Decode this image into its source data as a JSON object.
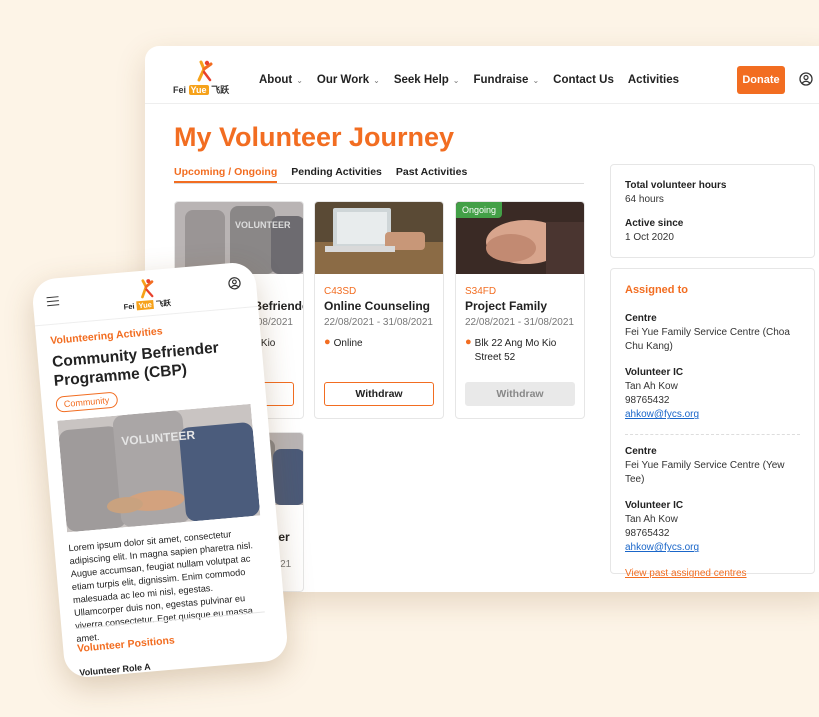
{
  "nav": {
    "logo_text_a": "Fei",
    "logo_text_b": "Yue",
    "logo_text_c": "飞跃",
    "links": [
      {
        "label": "About",
        "has_menu": true
      },
      {
        "label": "Our Work",
        "has_menu": true
      },
      {
        "label": "Seek Help",
        "has_menu": true
      },
      {
        "label": "Fundraise",
        "has_menu": true
      },
      {
        "label": "Contact Us",
        "has_menu": false
      },
      {
        "label": "Activities",
        "has_menu": false
      }
    ],
    "chevron": "⌄",
    "donate_label": "Donate"
  },
  "page": {
    "title": "My Volunteer Journey",
    "tabs": [
      "Upcoming / Ongoing",
      "Pending Activities",
      "Past Activities"
    ]
  },
  "cards": [
    {
      "code": "",
      "name": "Community Befriender",
      "date": "22/08/2021 - 31/08/2021",
      "location": "Blk 22 Ang Mo Kio",
      "button": "Withdraw"
    },
    {
      "code": "C43SD",
      "name": "Online Counseling",
      "date": "22/08/2021 - 31/08/2021",
      "location": "Online",
      "button": "Withdraw"
    },
    {
      "code": "S34FD",
      "name": "Project Family",
      "date": "22/08/2021 - 31/08/2021",
      "location": "Blk 22 Ang Mo Kio Street 52",
      "button": "Withdraw",
      "badge": "Ongoing"
    },
    {
      "name_tail": "ender",
      "date_tail": "2021"
    }
  ],
  "stats": {
    "hours_label": "Total volunteer hours",
    "hours_value": "64 hours",
    "since_label": "Active since",
    "since_value": "1 Oct 2020"
  },
  "assigned": {
    "heading": "Assigned to",
    "centres": [
      {
        "centre_label": "Centre",
        "centre": "Fei Yue Family Service Centre (Choa Chu Kang)",
        "ic_label": "Volunteer IC",
        "ic_name": "Tan Ah Kow",
        "phone": "98765432",
        "email": "ahkow@fycs.org"
      },
      {
        "centre_label": "Centre",
        "centre": "Fei Yue Family Service Centre (Yew Tee)",
        "ic_label": "Volunteer IC",
        "ic_name": "Tan Ah Kow",
        "phone": "98765432",
        "email": "ahkow@fycs.org"
      }
    ],
    "past_link": "View past assigned centres"
  },
  "mobile": {
    "category": "Volunteering Activities",
    "title": "Community Befriender Programme (CBP)",
    "tag": "Community",
    "body": "Lorem ipsum dolor sit amet, consectetur adipiscing elit. In magna sapien pharetra nisl. Augue accumsan, feugiat nullam volutpat ac etiam turpis elit, dignissim. Enim commodo malesuada ac leo mi nisl, egestas. Ullamcorper duis non, egestas pulvinar eu viverra consectetur. Eget quisque eu massa amet.",
    "positions_heading": "Volunteer Positions",
    "role": "Volunteer Role A"
  },
  "colors": {
    "accent": "#f26d21",
    "ongoing": "#43a047",
    "link": "#1a66c9",
    "background": "#fdf4e7"
  }
}
